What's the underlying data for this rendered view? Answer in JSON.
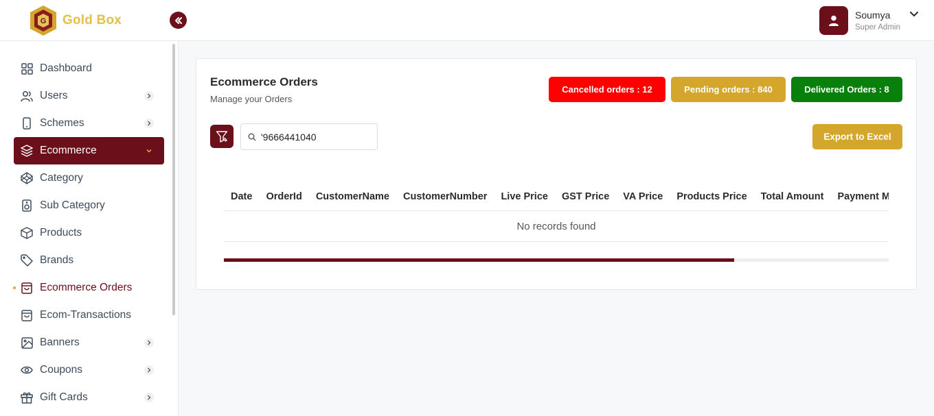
{
  "app": {
    "name": "Gold Box"
  },
  "user": {
    "name": "Soumya",
    "role": "Super Admin"
  },
  "sidebar": {
    "items": [
      {
        "label": "Dashboard",
        "icon": "grid-icon",
        "has_arrow": false
      },
      {
        "label": "Users",
        "icon": "users-icon",
        "has_arrow": true
      },
      {
        "label": "Schemes",
        "icon": "phone-icon",
        "has_arrow": true
      },
      {
        "label": "Ecommerce",
        "icon": "layers-icon",
        "has_arrow": true,
        "active": true
      },
      {
        "label": "Category",
        "icon": "codepen-icon",
        "has_arrow": false
      },
      {
        "label": "Sub Category",
        "icon": "speaker-icon",
        "has_arrow": false
      },
      {
        "label": "Products",
        "icon": "box-icon",
        "has_arrow": false
      },
      {
        "label": "Brands",
        "icon": "tag-icon",
        "has_arrow": false
      },
      {
        "label": "Ecommerce Orders",
        "icon": "shopping-bag-icon",
        "has_arrow": false,
        "current": true
      },
      {
        "label": "Ecom-Transactions",
        "icon": "shopping-bag-icon",
        "has_arrow": false
      },
      {
        "label": "Banners",
        "icon": "image-icon",
        "has_arrow": true
      },
      {
        "label": "Coupons",
        "icon": "eye-icon",
        "has_arrow": true
      },
      {
        "label": "Gift Cards",
        "icon": "gift-icon",
        "has_arrow": true
      }
    ]
  },
  "main": {
    "title": "Ecommerce Orders",
    "subtitle": "Manage your Orders",
    "badges": {
      "cancelled": "Cancelled orders : 12",
      "pending": "Pending orders : 840",
      "delivered": "Delivered Orders : 8"
    },
    "search": {
      "value": "'9666441040",
      "placeholder": ""
    },
    "export_label": "Export to Excel",
    "table": {
      "columns": [
        "Date",
        "OrderId",
        "CustomerName",
        "CustomerNumber",
        "Live Price",
        "GST Price",
        "VA Price",
        "Products Price",
        "Total Amount",
        "Payment M"
      ],
      "empty_message": "No records found"
    },
    "scroll_progress": 0.77
  },
  "colors": {
    "brand": "#6b0f1a",
    "gold": "#d4a72c",
    "cancelled": "#ff0000",
    "delivered": "#08800b"
  }
}
